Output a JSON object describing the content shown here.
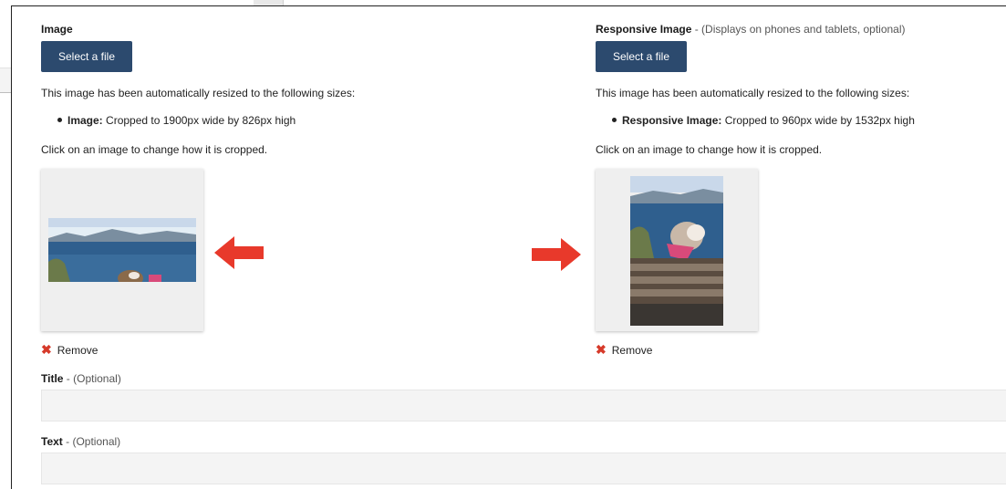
{
  "left": {
    "label": "Image",
    "button": "Select a file",
    "resize_text": "This image has been automatically resized to the following sizes:",
    "bullet_name": "Image:",
    "bullet_detail": "Cropped to 1900px wide by 826px high",
    "click_text": "Click on an image to change how it is cropped.",
    "remove_label": "Remove"
  },
  "right": {
    "label": "Responsive Image",
    "label_hint": "- (Displays on phones and tablets, optional)",
    "button": "Select a file",
    "resize_text": "This image has been automatically resized to the following sizes:",
    "bullet_name": "Responsive Image:",
    "bullet_detail": "Cropped to 960px wide by 1532px high",
    "click_text": "Click on an image to change how it is cropped.",
    "remove_label": "Remove"
  },
  "title_field": {
    "label": "Title",
    "hint": "- (Optional)"
  },
  "text_field": {
    "label": "Text",
    "hint": "- (Optional)"
  },
  "colors": {
    "button": "#2c4a6e",
    "arrow": "#e8392b",
    "remove_x": "#d63a2a"
  },
  "icons": {
    "arrow_left": "left-arrow-icon",
    "arrow_right": "right-arrow-icon",
    "remove": "x-icon"
  }
}
